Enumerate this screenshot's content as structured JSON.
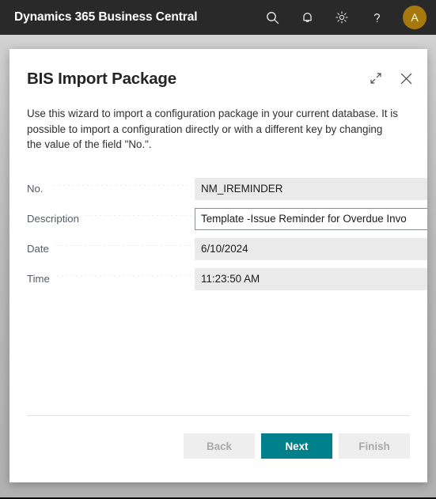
{
  "topbar": {
    "app_title": "Dynamics 365 Business Central",
    "icons": [
      {
        "name": "search-icon",
        "label": "Search"
      },
      {
        "name": "bell-icon",
        "label": "Notifications"
      },
      {
        "name": "gear-icon",
        "label": "Settings"
      },
      {
        "name": "help-icon",
        "label": "Help"
      }
    ],
    "avatar_initial": "A",
    "avatar_color": "#a6790c",
    "background_color": "#292929"
  },
  "dialog": {
    "title": "BIS Import Package",
    "expand_icon_label": "Expand",
    "close_icon_label": "Close",
    "description": "Use this wizard to import a configuration package in your current database. It is possible to import a configuration directly or with a different key by changing the value of the field \"No.\".",
    "fields": [
      {
        "label": "No.",
        "value": "NM_IREMINDER",
        "focused": false
      },
      {
        "label": "Description",
        "value": "Template -Issue Reminder for Overdue Invo",
        "focused": true
      },
      {
        "label": "Date",
        "value": "6/10/2024",
        "focused": false
      },
      {
        "label": "Time",
        "value": "11:23:50 AM",
        "focused": false
      }
    ],
    "buttons": {
      "back": "Back",
      "next": "Next",
      "finish": "Finish"
    },
    "accent_color": "#00808a"
  }
}
